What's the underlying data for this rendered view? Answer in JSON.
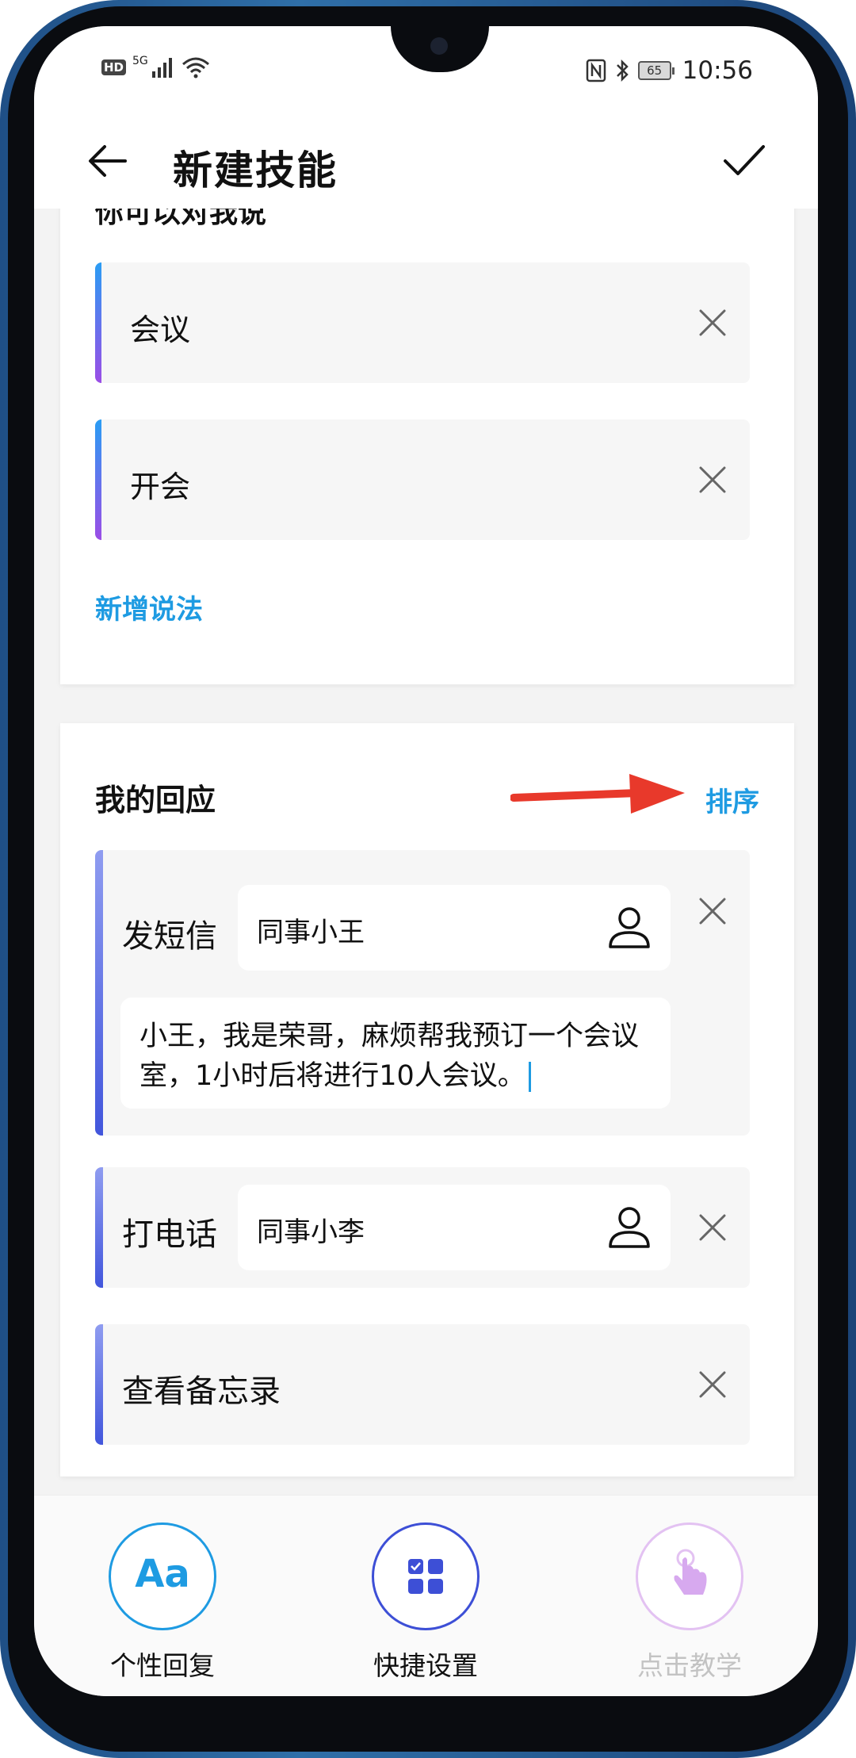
{
  "status_bar": {
    "hd": "HD",
    "network": "5G",
    "battery": "65",
    "time": "10:56"
  },
  "header": {
    "title": "新建技能"
  },
  "phrases_section": {
    "title": "你可以对我说",
    "items": [
      {
        "text": "会议"
      },
      {
        "text": "开会"
      }
    ],
    "add_label": "新增说法"
  },
  "responses_section": {
    "title": "我的回应",
    "sort_label": "排序",
    "items": [
      {
        "action": "发短信",
        "contact": "同事小王",
        "message": "小王，我是荣哥，麻烦帮我预订一个会议室，1小时后将进行10人会议。"
      },
      {
        "action": "打电话",
        "contact": "同事小李"
      },
      {
        "action": "查看备忘录"
      }
    ]
  },
  "bottom_bar": {
    "tabs": [
      {
        "icon_text": "Aa",
        "label": "个性回复",
        "color": "#1e9be2"
      },
      {
        "label": "快捷设置",
        "color": "#3d4fd6"
      },
      {
        "label": "点击教学",
        "color": "#d7a9ef"
      }
    ]
  },
  "colors": {
    "accent": "#1e9be2",
    "annotation_arrow": "#e8392b"
  }
}
